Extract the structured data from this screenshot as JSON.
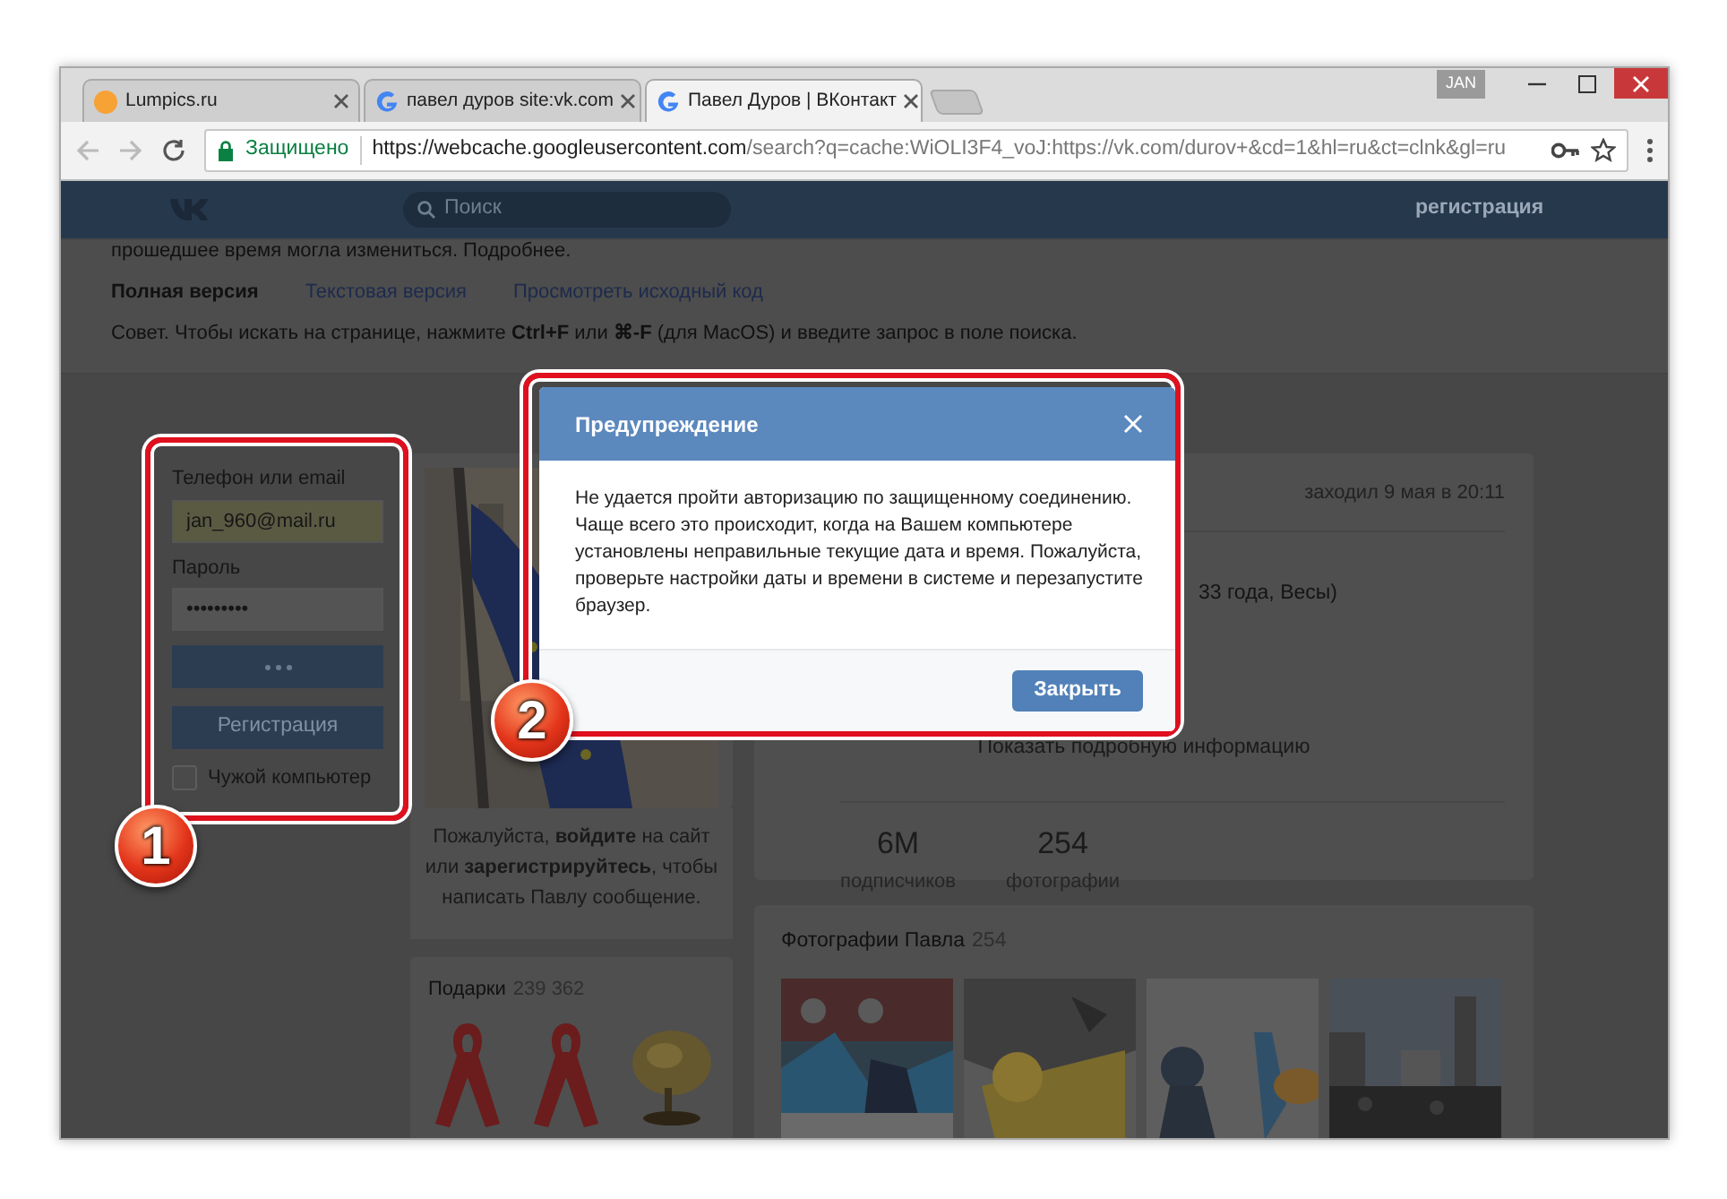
{
  "browser": {
    "tabs": [
      {
        "title": "Lumpics.ru",
        "kind": "lumpics",
        "selected": false
      },
      {
        "title": "павел дуров site:vk.com",
        "kind": "google",
        "selected": false
      },
      {
        "title": "Павел Дуров | ВКонтакт",
        "kind": "google",
        "selected": true
      }
    ],
    "user_badge": "JAN",
    "address": {
      "security": "Защищено",
      "url_host": "https://webcache.googleusercontent.com",
      "url_rest": "/search?q=cache:WiOLI3F4_voJ:https://vk.com/durov+&cd=1&hl=ru&ct=clnk&gl=ru"
    }
  },
  "header": {
    "search_placeholder": "Поиск",
    "link": "регистрация"
  },
  "cache_notice": {
    "line": "прошедшее время могла измениться. Подробнее.",
    "versions": [
      {
        "label": "Полная версия",
        "selected": true
      },
      {
        "label": "Текстовая версия",
        "selected": false
      },
      {
        "label": "Просмотреть исходный код",
        "selected": false
      }
    ],
    "tip": "Совет. Чтобы искать на странице, нажмите **Ctrl+F** или **⌘-F** (для MacOS) и введите запрос в поле поиска."
  },
  "login": {
    "phone_label": "Телефон или email",
    "phone_value": "jan_960@mail.ru",
    "password_label": "Пароль",
    "password_value": "•••••••••",
    "login_loading": true,
    "register_button": "Регистрация",
    "remember": {
      "label": "Чужой компьютер",
      "checked": false
    }
  },
  "message": "Пожалуйста, **войдите** на сайт или **зарегистрируйтесь**, чтобы написать Павлу сообщение.",
  "gifts": {
    "title": "Подарки",
    "count": "239 362",
    "items": [
      {
        "kind": "ribbon"
      },
      {
        "kind": "ribbon"
      },
      {
        "kind": "picture"
      }
    ]
  },
  "profile": {
    "last_seen": "заходил 9 мая в 20:11",
    "info": "33 года, Весы)",
    "more": "Показать подробную информацию",
    "counters": [
      {
        "value": "6M",
        "label": "подписчиков"
      },
      {
        "value": "254",
        "label": "фотографии"
      }
    ]
  },
  "photos": {
    "title": "Фотографии Павла",
    "count": "254",
    "items": [
      {
        "kind": "picture"
      },
      {
        "kind": "picture"
      },
      {
        "kind": "picture"
      },
      {
        "kind": "picture"
      }
    ]
  },
  "dialog": {
    "title": "Предупреждение",
    "text": "Не удается пройти авторизацию по защищенному соединению. Чаще всего это происходит, когда на Вашем компьютере установлены неправильные текущие дата и время. Пожалуйста, проверьте настройки даты и времени в системе и перезапустите браузер.",
    "button": "Закрыть"
  },
  "annotations": [
    {
      "number": "1"
    },
    {
      "number": "2"
    }
  ]
}
